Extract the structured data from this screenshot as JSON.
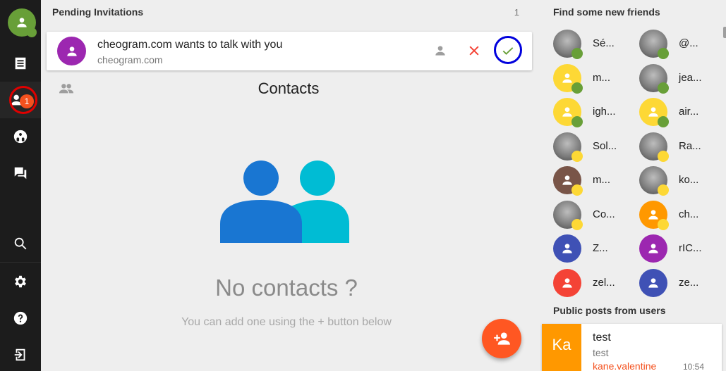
{
  "sidebar": {
    "badge_count": "1",
    "items": [
      {
        "name": "profile",
        "icon": "person-icon"
      },
      {
        "name": "news",
        "icon": "receipt-icon"
      },
      {
        "name": "contacts",
        "icon": "contacts-icon",
        "active": true
      },
      {
        "name": "groups",
        "icon": "group-work-icon"
      },
      {
        "name": "chats",
        "icon": "forum-icon"
      },
      {
        "name": "search",
        "icon": "search-icon"
      },
      {
        "name": "settings",
        "icon": "gear-icon"
      },
      {
        "name": "help",
        "icon": "help-icon"
      },
      {
        "name": "logout",
        "icon": "exit-icon"
      }
    ]
  },
  "pending": {
    "title": "Pending Invitations",
    "count": "1",
    "invitation": {
      "title": "cheogram.com wants to talk with you",
      "subtitle": "cheogram.com",
      "avatar_color": "#9c27b0"
    }
  },
  "contacts": {
    "title": "Contacts",
    "empty_title": "No contacts ?",
    "empty_subtitle": "You can add one using the + button below",
    "illustration_colors": [
      "#1976d2",
      "#00bcd4"
    ]
  },
  "fab": {
    "icon": "person-add-icon",
    "color": "#ff5722"
  },
  "friends": {
    "title": "Find some new friends",
    "items": [
      {
        "name": "Sé...",
        "avatar": "photo",
        "status": "#689f38"
      },
      {
        "name": "@...",
        "avatar": "photo",
        "status": "#689f38"
      },
      {
        "name": "m...",
        "avatar": "#fdd835",
        "status": "#689f38"
      },
      {
        "name": "jea...",
        "avatar": "photo",
        "status": "#689f38"
      },
      {
        "name": "igh...",
        "avatar": "#fdd835",
        "status": "#689f38"
      },
      {
        "name": "air...",
        "avatar": "#fdd835",
        "status": "#689f38"
      },
      {
        "name": "Sol...",
        "avatar": "photo",
        "status": "#fdd835"
      },
      {
        "name": "Ra...",
        "avatar": "photo",
        "status": "#fdd835"
      },
      {
        "name": "m...",
        "avatar": "#795548",
        "status": "#fdd835"
      },
      {
        "name": "ko...",
        "avatar": "photo",
        "status": "#fdd835"
      },
      {
        "name": "Co...",
        "avatar": "photo",
        "status": "#fdd835"
      },
      {
        "name": "ch...",
        "avatar": "#ff9800",
        "status": "#fdd835"
      },
      {
        "name": "Z...",
        "avatar": "#3f51b5",
        "status": null
      },
      {
        "name": "rIC...",
        "avatar": "#9c27b0",
        "status": null
      },
      {
        "name": "zel...",
        "avatar": "#f44336",
        "status": null
      },
      {
        "name": "ze...",
        "avatar": "#3f51b5",
        "status": null
      }
    ]
  },
  "posts": {
    "title": "Public posts from users",
    "items": [
      {
        "initials": "Ka",
        "title": "test",
        "body": "test",
        "author": "kane.valentine",
        "time": "10:54"
      }
    ]
  }
}
